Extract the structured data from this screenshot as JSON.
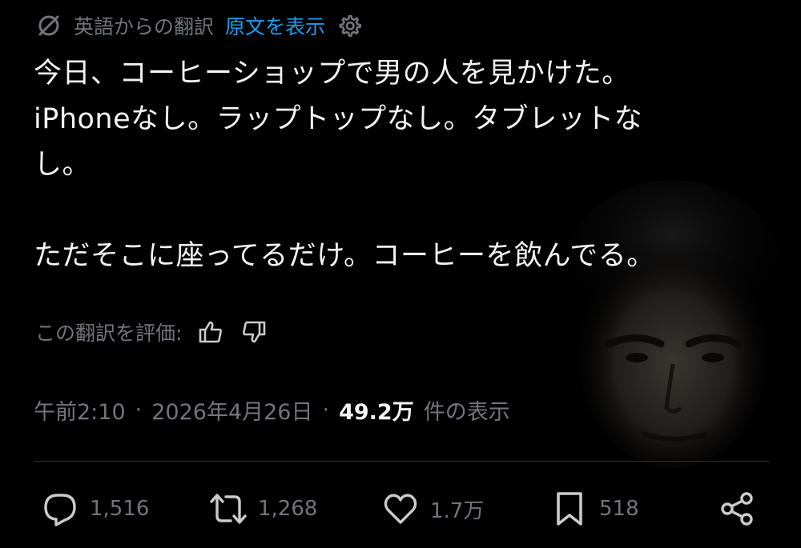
{
  "translation": {
    "label": "英語からの翻訳",
    "show_original": "原文を表示",
    "icon": "no-translate-icon",
    "settings_icon": "gear-icon"
  },
  "tweet": {
    "line1": "今日、コーヒーショップで男の人を見かけた。",
    "line2": "iPhoneなし。ラップトップなし。タブレットな",
    "line3": "し。",
    "line4": "ただそこに座ってるだけ。コーヒーを飲んでる。"
  },
  "rating": {
    "label": "この翻訳を評価:",
    "up_icon": "thumbs-up-icon",
    "down_icon": "thumbs-down-icon"
  },
  "meta": {
    "time": "午前2:10",
    "separator": "·",
    "date": "2026年4月26日",
    "views_count": "49.2万",
    "views_label": "件の表示"
  },
  "actions": {
    "replies": "1,516",
    "retweets": "1,268",
    "likes": "1.7万",
    "bookmarks": "518"
  },
  "colors": {
    "background": "#000000",
    "text": "#f2f3f4",
    "muted": "#71767b",
    "link": "#1d9bf0",
    "divider": "#2f3336"
  }
}
